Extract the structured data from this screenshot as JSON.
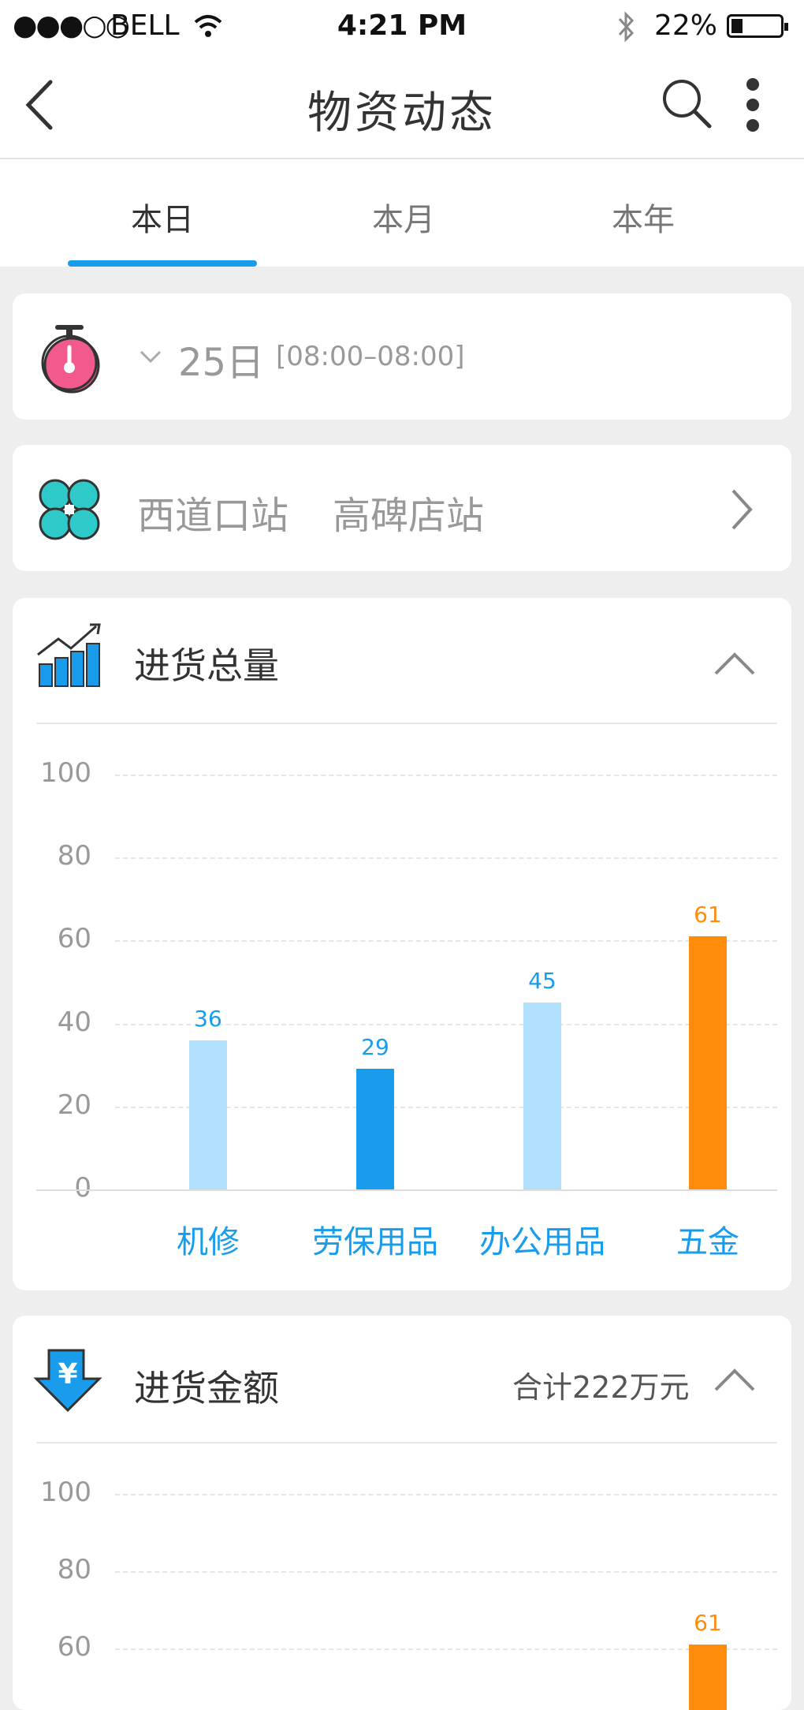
{
  "status": {
    "signal": "●●●○○",
    "carrier": "BELL",
    "time": "4:21 PM",
    "battery": "22%"
  },
  "nav": {
    "title": "物资动态"
  },
  "tabs": [
    {
      "label": "本日",
      "active": true
    },
    {
      "label": "本月",
      "active": false
    },
    {
      "label": "本年",
      "active": false
    }
  ],
  "date_filter": {
    "day": "25日",
    "range": "[08:00–08:00]"
  },
  "stations": {
    "items": [
      "西道口站",
      "高碑店站"
    ]
  },
  "section1": {
    "title": "进货总量"
  },
  "section2": {
    "title": "进货金额",
    "total": "合计222万元"
  },
  "chart_data": [
    {
      "type": "bar",
      "categories": [
        "机修",
        "劳保用品",
        "办公用品",
        "五金"
      ],
      "values": [
        36,
        29,
        45,
        61
      ],
      "colors": [
        "#b3e0fc",
        "#1a9cec",
        "#b3e0fc",
        "#ff8c0a"
      ],
      "ylim": [
        0,
        100
      ],
      "yticks": [
        0,
        20,
        40,
        60,
        80,
        100
      ],
      "grid": true,
      "title": "",
      "xlabel": "",
      "ylabel": ""
    },
    {
      "type": "bar",
      "visible_yticks": [
        100,
        80,
        60
      ],
      "ylim": [
        0,
        100
      ],
      "visible_values": [
        {
          "category_index": 3,
          "value": 61
        }
      ],
      "grid": true
    }
  ],
  "colors": {
    "accent": "#1a9cec",
    "orange": "#ff8c0a",
    "light_blue": "#b3e0fc"
  }
}
